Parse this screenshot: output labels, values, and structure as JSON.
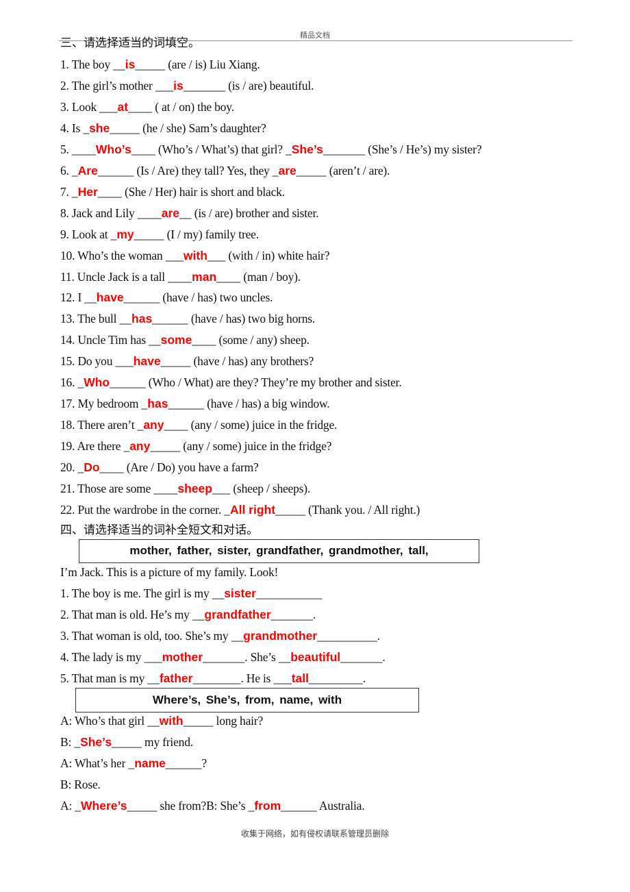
{
  "page": {
    "header": "精品文档",
    "footer": "收集于网络，如有侵权请联系管理员删除"
  },
  "section3": {
    "heading": "三、请选择适当的词填空。",
    "items": [
      {
        "prefix": "1. The boy ",
        "pre_blank": "__",
        "answer": "is",
        "post_blank": "_____",
        "suffix": " (are / is) Liu Xiang."
      },
      {
        "prefix": "2. The girl’s mother ",
        "pre_blank": "___",
        "answer": "is",
        "post_blank": "_______",
        "suffix": " (is / are) beautiful."
      },
      {
        "prefix": "3. Look ",
        "pre_blank": "___",
        "answer": "at",
        "post_blank": "____",
        "suffix": " ( at / on) the boy."
      },
      {
        "prefix": "4. Is ",
        "pre_blank": "_",
        "answer": "she",
        "post_blank": "_____",
        "suffix": " (he / she) Sam’s daughter?"
      },
      {
        "prefix": "5. ",
        "pre_blank": "____",
        "answer": "Who’s",
        "post_blank": "____",
        "suffix": " (Who’s / What’s) that girl? ",
        "pre_blank2": "_",
        "answer2": "She’s",
        "post_blank2": "_______",
        "suffix2": " (She’s / He’s) my sister?"
      },
      {
        "prefix": "6. ",
        "pre_blank": "_",
        "answer": "Are",
        "post_blank": "______",
        "suffix": " (Is / Are) they tall? Yes, they ",
        "pre_blank2": "_",
        "answer2": "are",
        "post_blank2": "_____",
        "suffix2": " (aren’t / are)."
      },
      {
        "prefix": "7. ",
        "pre_blank": "_",
        "answer": "Her",
        "post_blank": "____",
        "suffix": " (She / Her) hair is short and black."
      },
      {
        "prefix": "8. Jack and Lily ",
        "pre_blank": "____",
        "answer": "are",
        "post_blank": "__",
        "suffix": " (is / are) brother and sister."
      },
      {
        "prefix": "9. Look at ",
        "pre_blank": "_",
        "answer": "my",
        "post_blank": "_____",
        "suffix": " (I / my) family tree."
      },
      {
        "prefix": "10. Who’s the woman ",
        "pre_blank": "___",
        "answer": "with",
        "post_blank": "___",
        "suffix": " (with / in) white hair?"
      },
      {
        "prefix": "11. Uncle Jack is a tall ",
        "pre_blank": "____",
        "answer": "man",
        "post_blank": "____",
        "suffix": " (man / boy)."
      },
      {
        "prefix": "12. I ",
        "pre_blank": "__",
        "answer": "have",
        "post_blank": "______",
        "suffix": " (have / has) two uncles."
      },
      {
        "prefix": "13. The bull ",
        "pre_blank": "__",
        "answer": "has",
        "post_blank": "______",
        "suffix": " (have / has) two big horns."
      },
      {
        "prefix": "14. Uncle Tim has ",
        "pre_blank": "__",
        "answer": "some",
        "post_blank": "____",
        "suffix": " (some / any) sheep."
      },
      {
        "prefix": "15. Do you ",
        "pre_blank": "___",
        "answer": "have",
        "post_blank": "_____",
        "suffix": " (have / has) any brothers?"
      },
      {
        "prefix": "16. ",
        "pre_blank": "_",
        "answer": "Who",
        "post_blank": "______",
        "suffix": " (Who / What) are they? They’re my brother and sister."
      },
      {
        "prefix": "17. My bedroom ",
        "pre_blank": "_",
        "answer": "has",
        "post_blank": "______",
        "suffix": " (have / has) a big window."
      },
      {
        "prefix": "18. There aren’t ",
        "pre_blank": "_",
        "answer": "any",
        "post_blank": "____",
        "suffix": " (any / some) juice in the fridge."
      },
      {
        "prefix": "19. Are there ",
        "pre_blank": "_",
        "answer": "any",
        "post_blank": "_____",
        "suffix": " (any / some) juice in the fridge?"
      },
      {
        "prefix": "20. ",
        "pre_blank": "_",
        "answer": "Do",
        "post_blank": "____",
        "suffix": " (Are / Do) you have a farm?"
      },
      {
        "prefix": "21. Those are some ",
        "pre_blank": "____",
        "answer": "sheep",
        "post_blank": "___",
        "suffix": " (sheep / sheeps)."
      },
      {
        "prefix": "22. Put the wardrobe in the corner. ",
        "pre_blank": "_",
        "answer": "All right",
        "post_blank": "_____",
        "suffix": " (Thank you. / All right.)"
      }
    ]
  },
  "section4": {
    "heading": "四、请选择适当的词补全短文和对话。",
    "word_box_1": "mother,  father,  sister,  grandfather,  grandmother,  tall,",
    "intro": "I’m Jack. This is a picture of my family. Look!",
    "passage": [
      {
        "prefix": "1. The boy is me. The girl is my ",
        "pre_blank": "__",
        "answer": "sister",
        "post_blank": "___________",
        "suffix": ""
      },
      {
        "prefix": "2. That man is old. He’s my ",
        "pre_blank": "__",
        "answer": "grandfather",
        "post_blank": "_______",
        "suffix": "."
      },
      {
        "prefix": "3. That woman is old, too. She’s my ",
        "pre_blank": "__",
        "answer": "grandmother",
        "post_blank": "__________",
        "suffix": "."
      },
      {
        "prefix": "4. The lady is my ",
        "pre_blank": "___",
        "answer": "mother",
        "post_blank": "_______",
        "suffix": ". She’s ",
        "pre_blank2": "__",
        "answer2": "beautiful",
        "post_blank2": "_______",
        "suffix2": "."
      },
      {
        "prefix": "5. That man is my ",
        "pre_blank": "__",
        "answer": "father",
        "post_blank": "________",
        "suffix": ". He is ",
        "pre_blank2": "___",
        "answer2": "tall",
        "post_blank2": "_________",
        "suffix2": "."
      }
    ],
    "word_box_2": "Where’s,  She’s,  from,  name,  with",
    "dialogue": [
      {
        "prefix": "A: Who’s that girl ",
        "pre_blank": "__",
        "answer": "with",
        "post_blank": "_____",
        "suffix": " long hair?"
      },
      {
        "prefix": "B: ",
        "pre_blank": "_",
        "answer": "She’s",
        "post_blank": "_____",
        "suffix": " my friend."
      },
      {
        "prefix": "A: What’s her ",
        "pre_blank": "_",
        "answer": "name",
        "post_blank": "______",
        "suffix": "?"
      },
      {
        "prefix": "B: Rose.",
        "pre_blank": "",
        "answer": "",
        "post_blank": "",
        "suffix": ""
      },
      {
        "prefix": "A: ",
        "pre_blank": "_",
        "answer": "Where’s",
        "post_blank": "_____",
        "suffix": " she from?B: She’s ",
        "pre_blank2": "_",
        "answer2": "from",
        "post_blank2": "______",
        "suffix2": " Australia."
      }
    ]
  },
  "colors": {
    "answer": "#ff0000",
    "text": "#111111",
    "header_rule": "#9a9a9a"
  }
}
